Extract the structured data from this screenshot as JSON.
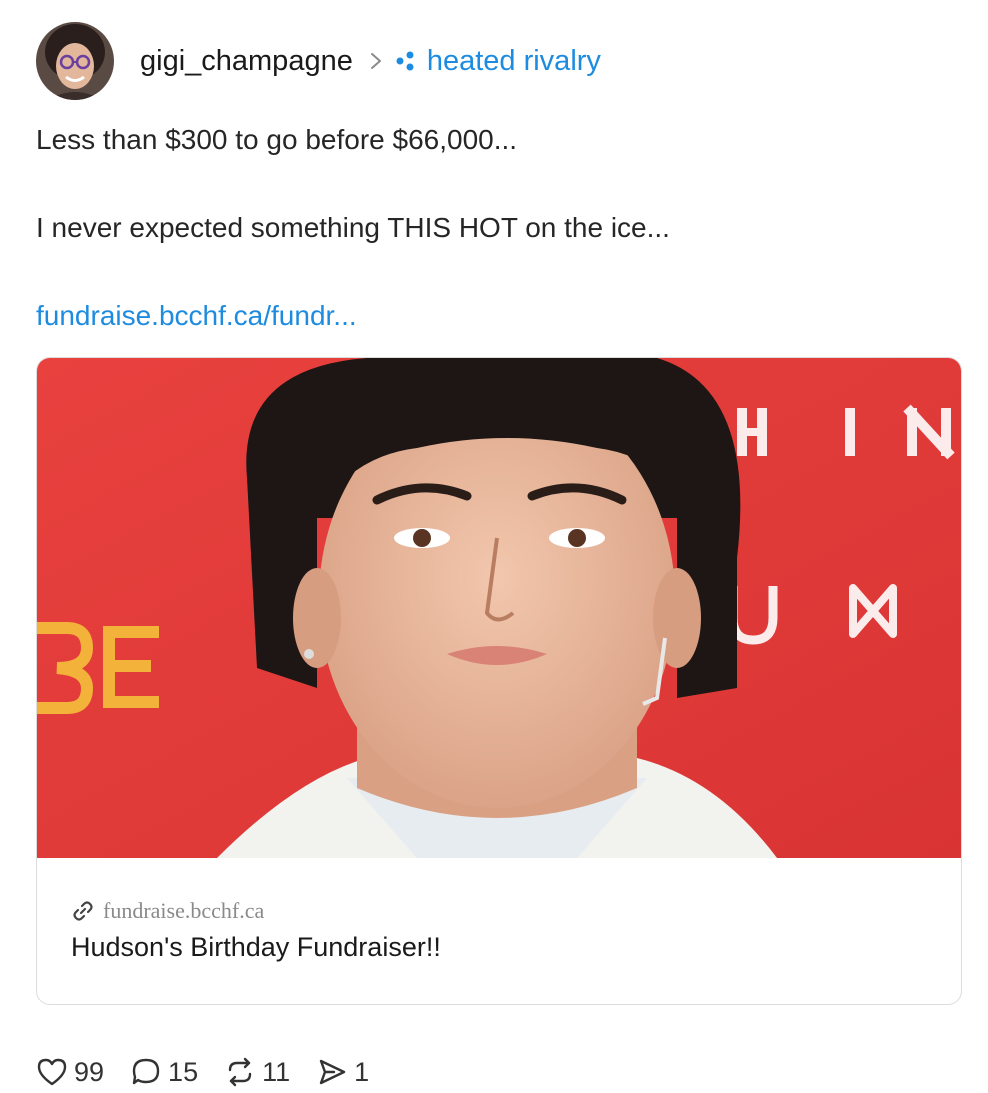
{
  "post": {
    "author": {
      "username": "gigi_champagne",
      "avatar_icon": "avatar-photo"
    },
    "community": {
      "name": "heated rivalry",
      "icon": "community-dots-icon",
      "color": "#1d8ce0"
    },
    "body": {
      "line1": "Less than $300 to go before $66,000...",
      "line2": "I never expected something THIS HOT on the ice...",
      "link_text": "fundraise.bcchf.ca/fundr..."
    },
    "link_card": {
      "domain": "fundraise.bcchf.ca",
      "title": "Hudson's Birthday Fundraiser!!",
      "image_background_color": "#e23b3b",
      "backdrop_letters": [
        "H I N",
        "U ⋈",
        "SE"
      ]
    },
    "actions": {
      "likes": "99",
      "comments": "15",
      "reposts": "11",
      "shares": "1"
    }
  }
}
